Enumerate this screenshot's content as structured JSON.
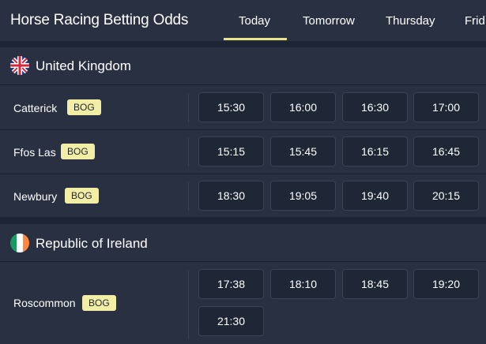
{
  "header": {
    "title": "Horse Racing Betting Odds",
    "tabs": [
      {
        "label": "Today",
        "active": true
      },
      {
        "label": "Tomorrow"
      },
      {
        "label": "Thursday"
      },
      {
        "label": "Frid"
      }
    ]
  },
  "colors": {
    "accent": "#e8e38a",
    "badge_bg": "#f3eea5",
    "page_bg": "#1d2433",
    "panel_bg": "#283041"
  },
  "countries": [
    {
      "name": "United Kingdom",
      "flag_icon": "uk-flag-icon",
      "meetings": [
        {
          "venue": "Catterick",
          "badge": "BOG",
          "times": [
            "15:30",
            "16:00",
            "16:30",
            "17:00"
          ]
        },
        {
          "venue": "Ffos Las",
          "badge": "BOG",
          "times": [
            "15:15",
            "15:45",
            "16:15",
            "16:45"
          ]
        },
        {
          "venue": "Newbury",
          "badge": "BOG",
          "times": [
            "18:30",
            "19:05",
            "19:40",
            "20:15"
          ]
        }
      ]
    },
    {
      "name": "Republic of Ireland",
      "flag_icon": "ireland-flag-icon",
      "meetings": [
        {
          "venue": "Roscommon",
          "badge": "BOG",
          "times": [
            "17:38",
            "18:10",
            "18:45",
            "19:20",
            "21:30"
          ]
        }
      ]
    }
  ]
}
